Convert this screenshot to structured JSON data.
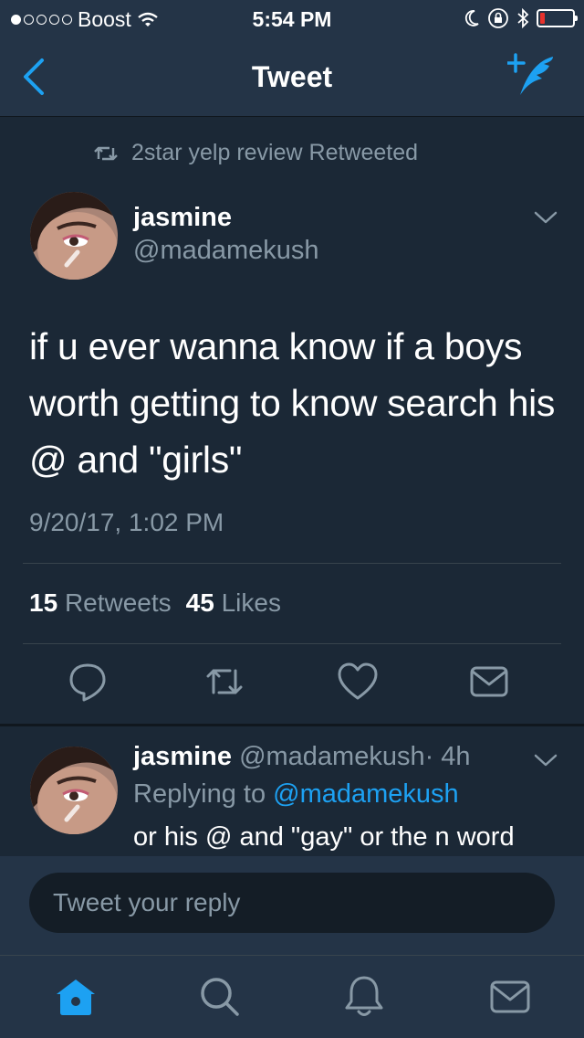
{
  "status_bar": {
    "carrier": "Boost",
    "time": "5:54 PM",
    "battery_level": 0.15
  },
  "nav": {
    "title": "Tweet"
  },
  "retweet_context": {
    "text": "2star yelp review Retweeted"
  },
  "tweet": {
    "author_name": "jasmine",
    "author_handle": "@madamekush",
    "text": "if u ever wanna know if a boys worth getting to know search his @ and \"girls\"",
    "timestamp": "9/20/17, 1:02 PM",
    "retweets_count": "15",
    "retweets_label": "Retweets",
    "likes_count": "45",
    "likes_label": "Likes"
  },
  "reply": {
    "author_name": "jasmine",
    "author_handle": "@madamekush",
    "time": "· 4h",
    "replying_prefix": "Replying to",
    "replying_to": "@madamekush",
    "text": "or his @ and \"gay\" or the n word"
  },
  "composer": {
    "placeholder": "Tweet your reply"
  },
  "tabbar": {
    "tabs": [
      "home-icon",
      "search-icon",
      "notifications-icon",
      "messages-icon"
    ]
  },
  "colors": {
    "accent": "#1da1f2",
    "background": "#1b2836",
    "bar": "#243447",
    "muted": "#8899a6"
  }
}
